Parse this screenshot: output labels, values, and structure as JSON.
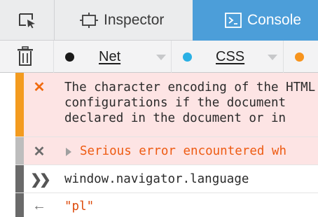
{
  "toolbar": {
    "tabs": [
      {
        "label": "Inspector",
        "icon": "inspector-box-icon",
        "active": false
      },
      {
        "label": "Console",
        "icon": "console-terminal-icon",
        "active": true
      }
    ],
    "picker_icon": "element-picker-icon",
    "active_color": "#4c9ed9"
  },
  "filters": {
    "clear_icon": "trash-icon",
    "items": [
      {
        "label": "Net",
        "color": "#1a1a1a"
      },
      {
        "label": "CSS",
        "color": "#2ab0e4"
      },
      {
        "label": "",
        "color": "#f7941d"
      }
    ]
  },
  "console": {
    "messages": [
      {
        "type": "error",
        "icon": "error-cross-icon",
        "lines": [
          "The character encoding of the HTML",
          "configurations if the document",
          "declared in the document or in"
        ]
      },
      {
        "type": "error-collapsed",
        "icon": "error-cross-icon",
        "text": "Serious error encountered wh"
      },
      {
        "type": "input",
        "icon": "input-prompt-icon",
        "text": "window.navigator.language"
      },
      {
        "type": "output",
        "icon": "output-arrow-icon",
        "text": "\"pl\""
      }
    ],
    "colors": {
      "warning_bar": "#f39b1f",
      "error_bg": "#fde4e4",
      "error_text": "#ee5b12",
      "string_text": "#dd4b0c"
    }
  }
}
